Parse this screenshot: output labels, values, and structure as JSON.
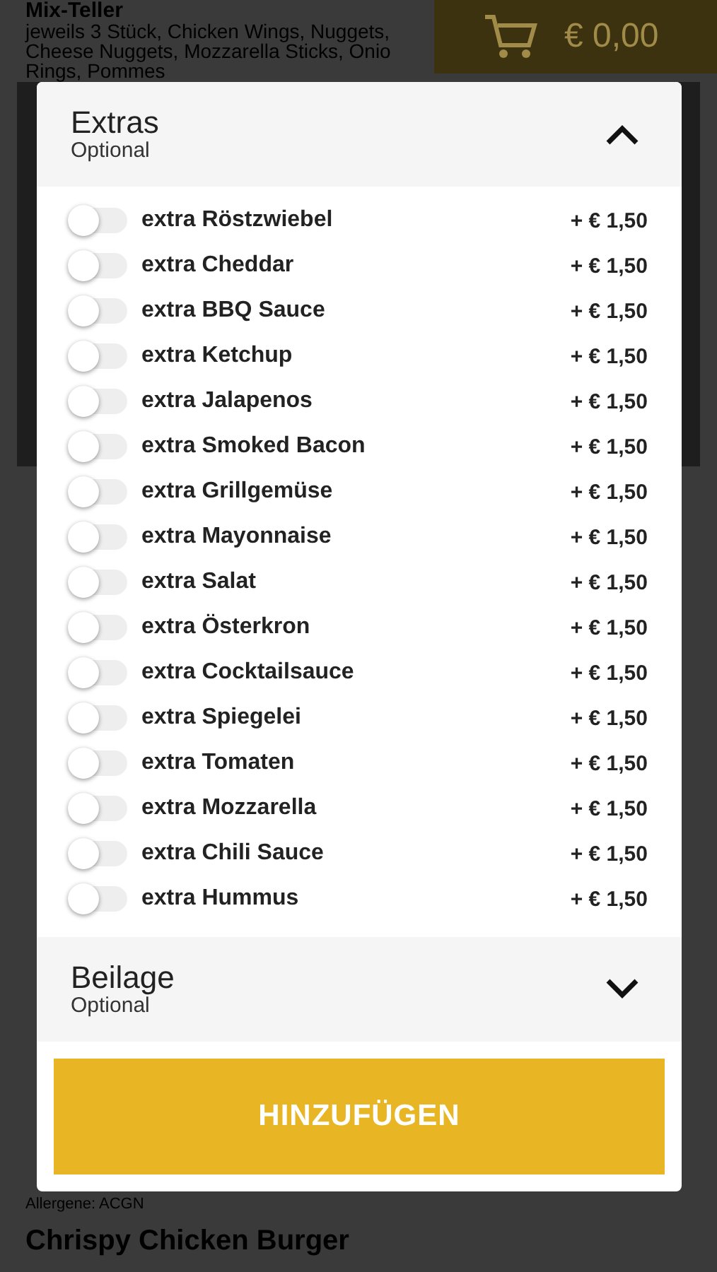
{
  "background": {
    "top_item": {
      "title": "Mix-Teller",
      "description": [
        "jeweils 3 Stück, Chicken Wings, Nuggets,",
        "Cheese Nuggets, Mozzarella Sticks, Onio",
        "Rings, Pommes"
      ]
    },
    "cart": {
      "total": "€ 0,00"
    },
    "allergens": "Allergene: ACGN",
    "next_item": {
      "title": "Chrispy Chicken Burger"
    }
  },
  "modal": {
    "sections": [
      {
        "title": "Extras",
        "subtitle": "Optional",
        "expanded": true,
        "options": [
          {
            "label": "extra Röstzwiebel",
            "price": "+ € 1,50",
            "on": false
          },
          {
            "label": "extra Cheddar",
            "price": "+ € 1,50",
            "on": false
          },
          {
            "label": "extra BBQ Sauce",
            "price": "+ € 1,50",
            "on": false
          },
          {
            "label": "extra Ketchup",
            "price": "+ € 1,50",
            "on": false
          },
          {
            "label": "extra Jalapenos",
            "price": "+ € 1,50",
            "on": false
          },
          {
            "label": "extra Smoked Bacon",
            "price": "+ € 1,50",
            "on": false
          },
          {
            "label": "extra Grillgemüse",
            "price": "+ € 1,50",
            "on": false
          },
          {
            "label": "extra Mayonnaise",
            "price": "+ € 1,50",
            "on": false
          },
          {
            "label": "extra Salat",
            "price": "+ € 1,50",
            "on": false
          },
          {
            "label": "extra Österkron",
            "price": "+ € 1,50",
            "on": false
          },
          {
            "label": "extra Cocktailsauce",
            "price": "+ € 1,50",
            "on": false
          },
          {
            "label": "extra Spiegelei",
            "price": "+ € 1,50",
            "on": false
          },
          {
            "label": "extra Tomaten",
            "price": "+ € 1,50",
            "on": false
          },
          {
            "label": "extra Mozzarella",
            "price": "+ € 1,50",
            "on": false
          },
          {
            "label": "extra Chili Sauce",
            "price": "+ € 1,50",
            "on": false
          },
          {
            "label": "extra Hummus",
            "price": "+ € 1,50",
            "on": false
          }
        ]
      },
      {
        "title": "Beilage",
        "subtitle": "Optional",
        "expanded": false
      }
    ],
    "add_button": "HINZUFÜGEN"
  }
}
